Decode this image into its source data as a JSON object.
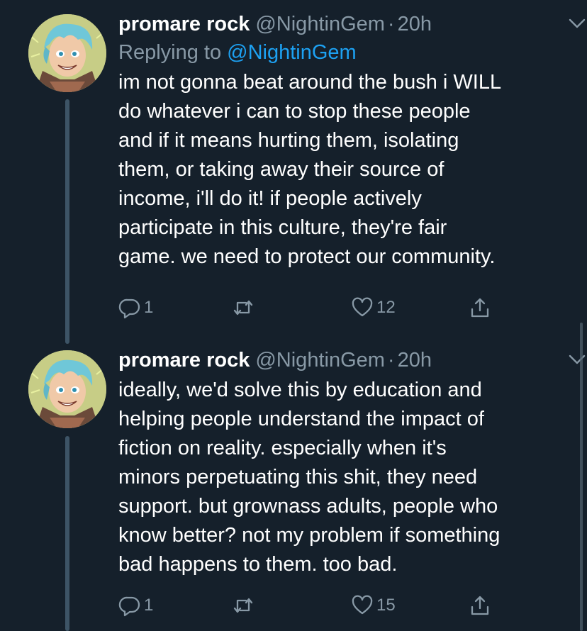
{
  "tweets": [
    {
      "name": "promare rock",
      "handle": "@NightinGem",
      "separator": "·",
      "time": "20h",
      "reply_prefix": "Replying to",
      "reply_mention": "@NightinGem",
      "text": "im not gonna beat around the bush i WILL\ndo whatever i can to stop these people\nand if it means hurting them, isolating\nthem, or taking away their source of\nincome, i'll do it! if people actively\nparticipate in this culture, they're fair\ngame. we need to protect our community.",
      "reply_count": "1",
      "retweet_count": "",
      "like_count": "12"
    },
    {
      "name": "promare rock",
      "handle": "@NightinGem",
      "separator": "·",
      "time": "20h",
      "text": "ideally, we'd solve this by education and\nhelping people understand the impact of\nfiction on reality. especially when it's\nminors perpetuating this shit, they need\nsupport. but grownass adults, people who\nknow better? not my problem if something\nbad happens to them. too bad.",
      "reply_count": "1",
      "retweet_count": "",
      "like_count": "15"
    }
  ],
  "icons": {
    "reply": "reply-icon",
    "retweet": "retweet-icon",
    "like": "heart-icon",
    "share": "share-icon",
    "menu": "chevron-down-icon"
  },
  "colors": {
    "background": "#15202b",
    "secondary_text": "#8899a6",
    "link": "#1da1f2",
    "thread_line": "#3d5466"
  }
}
